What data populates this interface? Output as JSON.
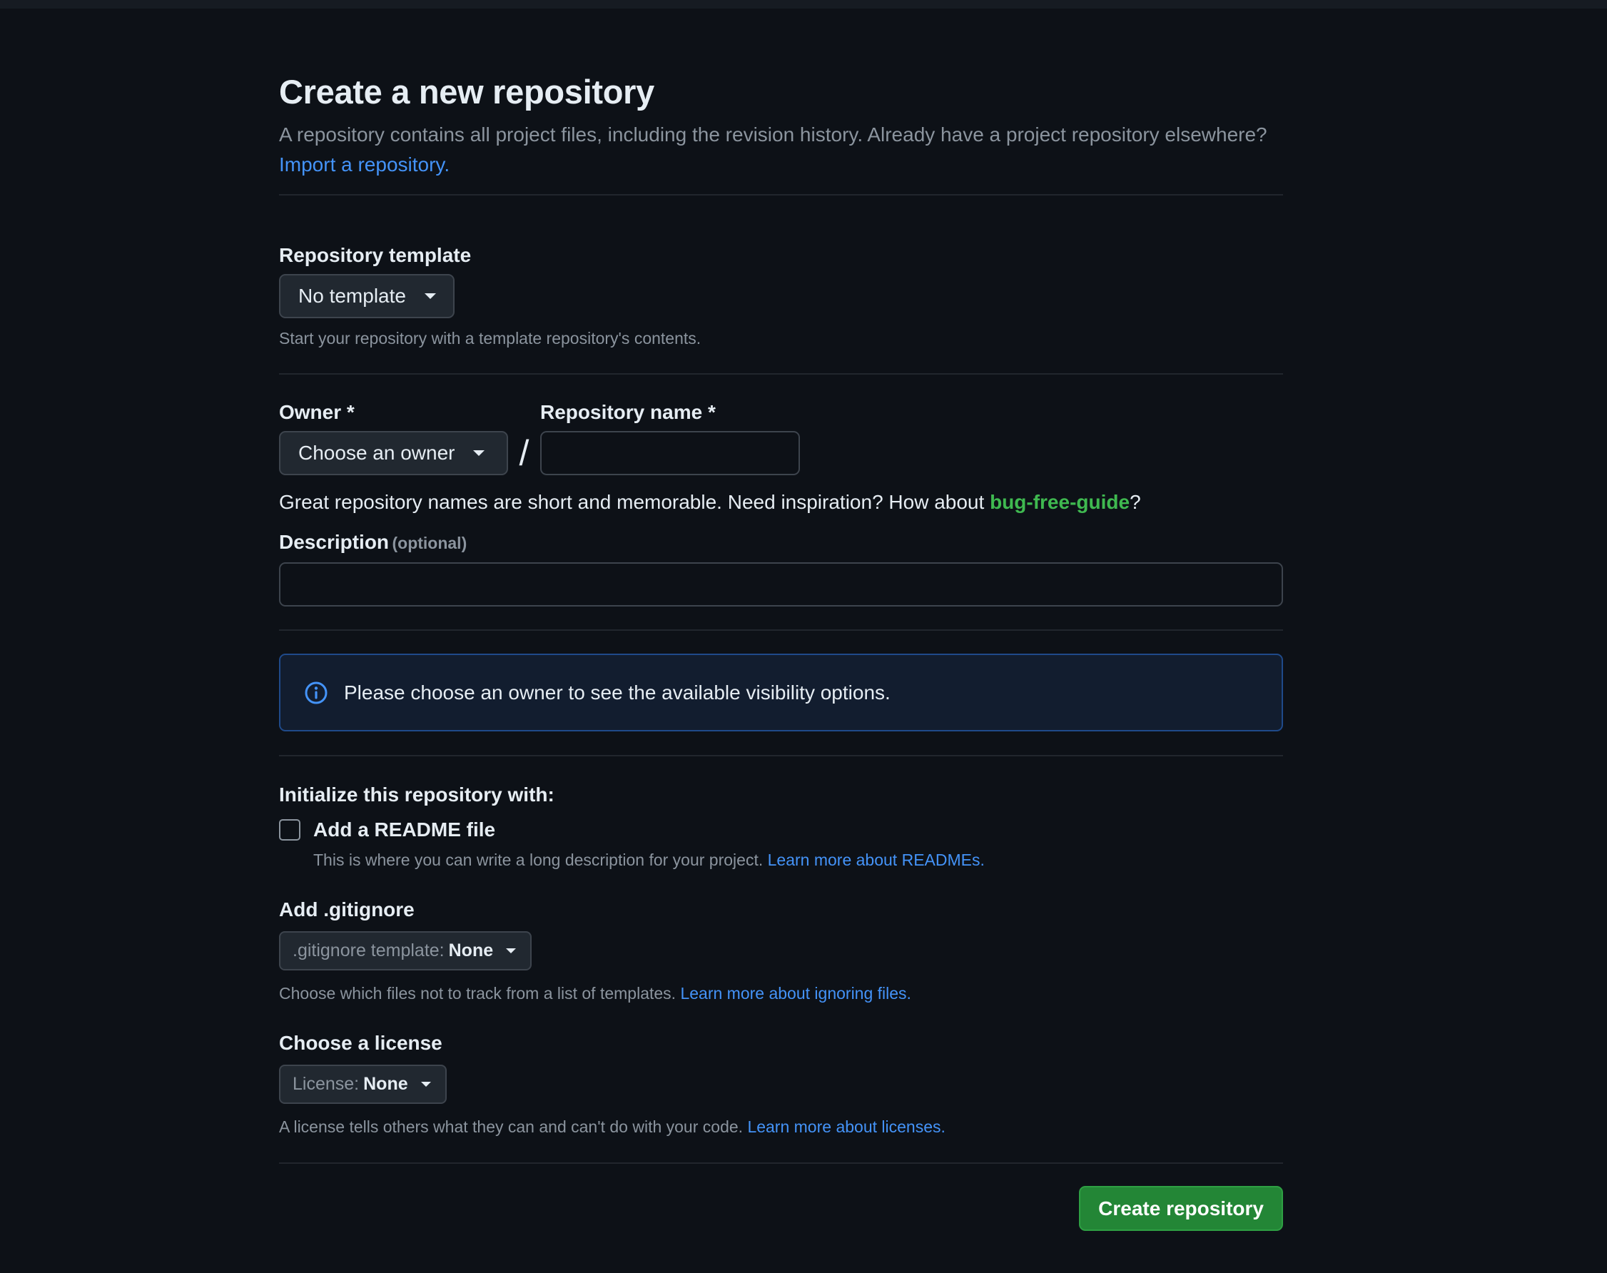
{
  "header": {
    "title": "Create a new repository",
    "intro_text": "A repository contains all project files, including the revision history. Already have a project repository elsewhere?",
    "import_link": "Import a repository."
  },
  "template": {
    "label": "Repository template",
    "select_value": "No template",
    "help": "Start your repository with a template repository's contents."
  },
  "owner": {
    "label": "Owner *",
    "select_value": "Choose an owner",
    "separator": "/"
  },
  "repo_name": {
    "label": "Repository name *",
    "value": "",
    "suggestion_prefix": "Great repository names are short and memorable. Need inspiration? How about",
    "suggestion": "bug-free-guide",
    "suggestion_suffix": "?"
  },
  "description": {
    "label": "Description",
    "optional": "(optional)",
    "value": ""
  },
  "visibility": {
    "message": "Please choose an owner to see the available visibility options."
  },
  "initialize": {
    "heading": "Initialize this repository with:",
    "readme_label": "Add a README file",
    "readme_help": "This is where you can write a long description for your project.",
    "readme_link": "Learn more about READMEs."
  },
  "gitignore": {
    "heading": "Add .gitignore",
    "select_prefix": ".gitignore template:",
    "select_value": "None",
    "help": "Choose which files not to track from a list of templates.",
    "link": "Learn more about ignoring files."
  },
  "license": {
    "heading": "Choose a license",
    "select_prefix": "License:",
    "select_value": "None",
    "help": "A license tells others what they can and can't do with your code.",
    "link": "Learn more about licenses."
  },
  "actions": {
    "create_label": "Create repository"
  },
  "colors": {
    "background": "#0d1117",
    "accent_link": "#4493f8",
    "suggestion_green": "#3fb950",
    "primary_button": "#238636"
  },
  "icons": {
    "info": "info-icon",
    "caret": "triangle-down-icon"
  }
}
